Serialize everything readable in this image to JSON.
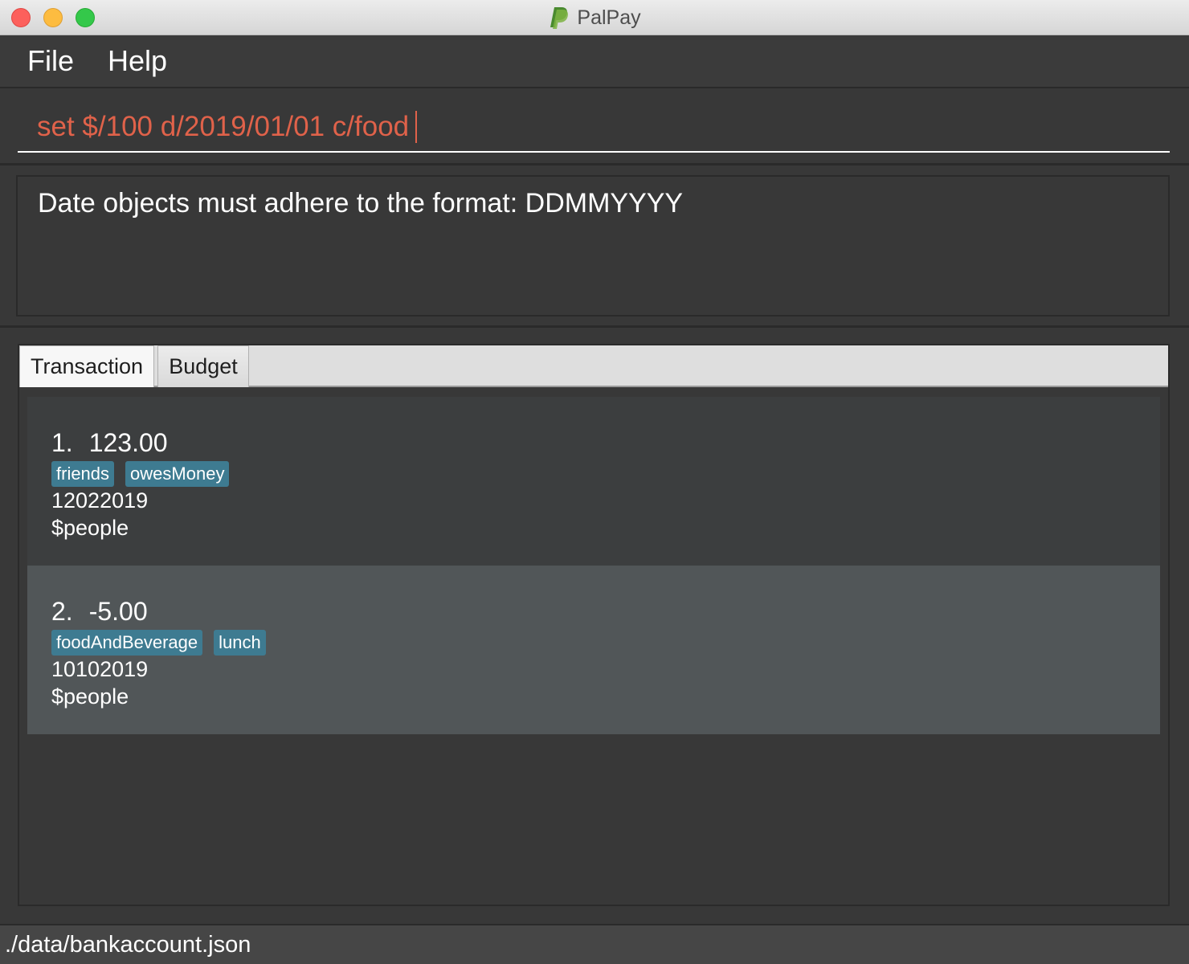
{
  "window": {
    "title": "PalPay",
    "logo_icon": "paypal-logo-icon"
  },
  "menu": {
    "items": [
      "File",
      "Help"
    ]
  },
  "command": {
    "value": "set $/100 d/2019/01/01 c/food"
  },
  "result": {
    "message": "Date objects must adhere to the format: DDMMYYYY"
  },
  "tabs": {
    "items": [
      "Transaction",
      "Budget"
    ],
    "selected": "Transaction"
  },
  "transactions": [
    {
      "index": "1.",
      "amount": "123.00",
      "tags": [
        "friends",
        "owesMoney"
      ],
      "date": "12022019",
      "person": "$people"
    },
    {
      "index": "2.",
      "amount": "-5.00",
      "tags": [
        "foodAndBeverage",
        "lunch"
      ],
      "date": "10102019",
      "person": "$people"
    }
  ],
  "status": {
    "file_path": "./data/bankaccount.json"
  },
  "colors": {
    "command_text": "#e0624a",
    "tag_background": "#3e7b91",
    "background": "#383838"
  }
}
